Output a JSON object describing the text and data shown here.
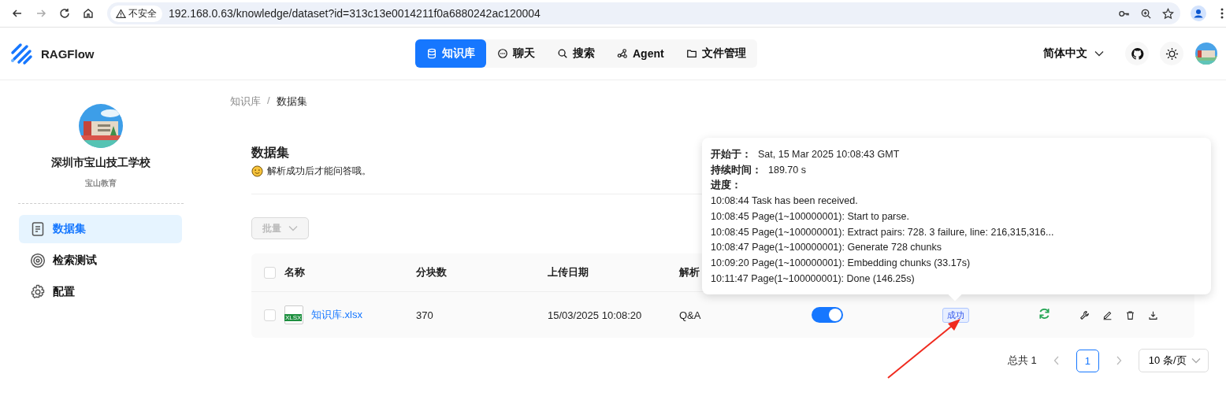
{
  "browser": {
    "security_label": "不安全",
    "url": "192.168.0.63/knowledge/dataset?id=313c13e0014211f0a6880242ac120004"
  },
  "app": {
    "brand": "RAGFlow",
    "language": "简体中文",
    "nav": [
      {
        "label": "知识库",
        "kind": "database",
        "selected": true
      },
      {
        "label": "聊天",
        "kind": "chat",
        "selected": false
      },
      {
        "label": "搜索",
        "kind": "search",
        "selected": false
      },
      {
        "label": "Agent",
        "kind": "graph",
        "selected": false
      },
      {
        "label": "文件管理",
        "kind": "folder",
        "selected": false
      }
    ]
  },
  "sidebar": {
    "name": "深圳市宝山技工学校",
    "subtitle": "宝山教育",
    "items": [
      {
        "label": "数据集",
        "kind": "doc",
        "selected": true
      },
      {
        "label": "检索测试",
        "kind": "target",
        "selected": false
      },
      {
        "label": "配置",
        "kind": "gear",
        "selected": false
      }
    ]
  },
  "breadcrumb": {
    "items": [
      {
        "label": "知识库",
        "current": false
      },
      {
        "label": "数据集",
        "current": true
      }
    ],
    "separator": "/"
  },
  "page": {
    "title": "数据集",
    "hint": "解析成功后才能问答哦。"
  },
  "batch_button": {
    "label": "批量",
    "disabled": true
  },
  "table": {
    "header_checked": false,
    "columns": [
      "名称",
      "分块数",
      "上传日期",
      "解析"
    ],
    "rows": [
      {
        "checked": false,
        "file_badge": "XLSX",
        "name": "知识库.xlsx",
        "chunks": "370",
        "date": "15/03/2025 10:08:20",
        "parser": "Q&A",
        "enabled": true,
        "status": "成功"
      }
    ]
  },
  "tooltip": {
    "fields": [
      {
        "label": "开始于：",
        "value": "Sat, 15 Mar 2025 10:08:43 GMT"
      },
      {
        "label": "持续时间：",
        "value": "189.70 s"
      }
    ],
    "progress_label": "进度：",
    "log": [
      "10:08:44 Task has been received.",
      "10:08:45 Page(1~100000001): Start to parse.",
      "10:08:45 Page(1~100000001): Extract pairs: 728. 3 failure, line: 216,315,316...",
      "10:08:47 Page(1~100000001): Generate 728 chunks",
      "10:09:20 Page(1~100000001): Embedding chunks (33.17s)",
      "10:11:47 Page(1~100000001): Done (146.25s)"
    ]
  },
  "pagination": {
    "total": "总共 1",
    "pages": [
      {
        "label": "1",
        "selected": true
      }
    ],
    "page_size": "10 条/页"
  }
}
